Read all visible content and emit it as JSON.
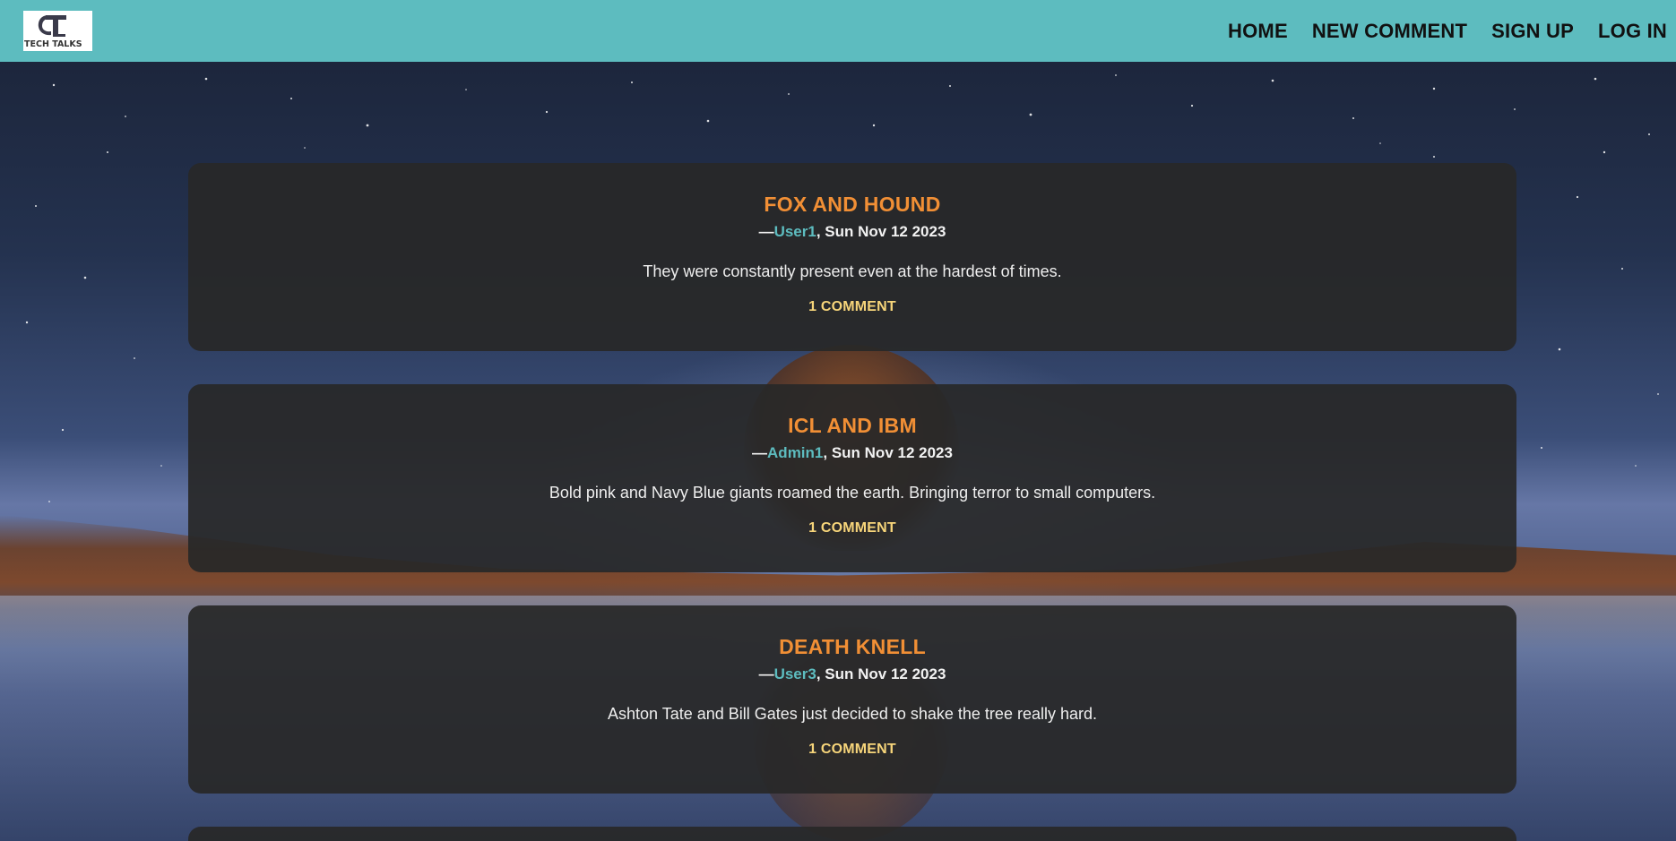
{
  "app": {
    "logo_text": "TECH TALKS",
    "logo_icon": "tech-talks-logo-icon"
  },
  "nav": {
    "links": [
      {
        "label": "HOME"
      },
      {
        "label": "NEW COMMENT"
      },
      {
        "label": "SIGN UP"
      },
      {
        "label": "LOG IN"
      }
    ]
  },
  "posts": [
    {
      "title": "FOX AND HOUND",
      "dash": "—",
      "author": "User1",
      "date": ", Sun Nov 12 2023",
      "body": "They were constantly present even at the hardest of times.",
      "comments": "1 COMMENT"
    },
    {
      "title": "ICL AND IBM",
      "dash": "—",
      "author": "Admin1",
      "date": ", Sun Nov 12 2023",
      "body": "Bold pink and Navy Blue giants roamed the earth. Bringing terror to small computers.",
      "comments": "1 COMMENT"
    },
    {
      "title": "DEATH KNELL",
      "dash": "—",
      "author": "User3",
      "date": ", Sun Nov 12 2023",
      "body": "Ashton Tate and Bill Gates just decided to shake the tree really hard.",
      "comments": "1 COMMENT"
    }
  ],
  "colors": {
    "header": "#5dbcbf",
    "title": "#f18f35",
    "author": "#5dbcbf",
    "comments": "#f7d57a",
    "card": "#282828"
  }
}
